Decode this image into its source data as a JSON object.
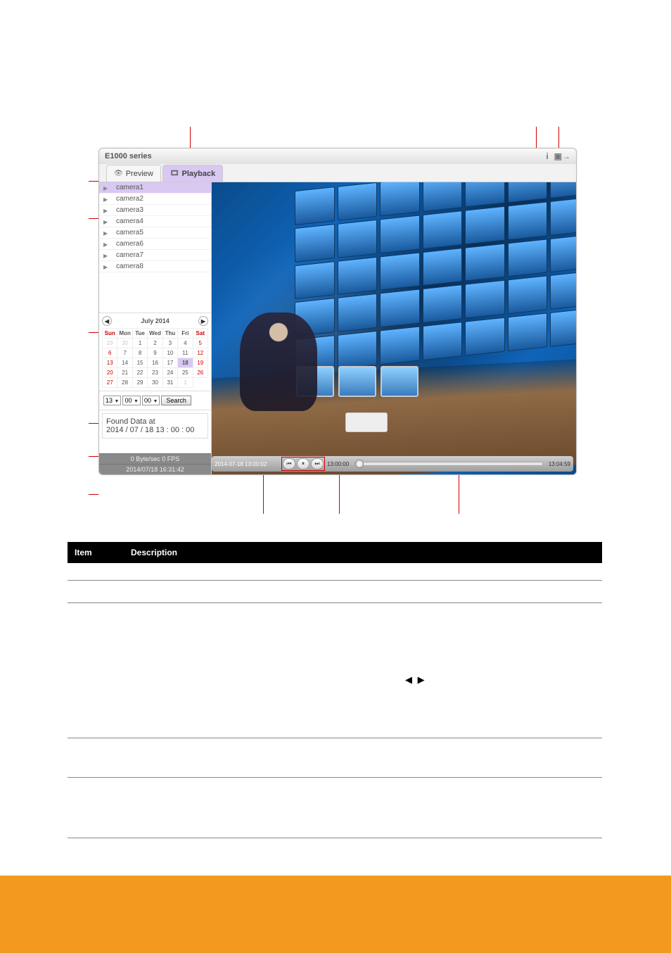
{
  "titlebar": {
    "title": "E1000 series"
  },
  "tabs": {
    "preview": "Preview",
    "playback": "Playback"
  },
  "cameras": [
    "camera1",
    "camera2",
    "camera3",
    "camera4",
    "camera5",
    "camera6",
    "camera7",
    "camera8"
  ],
  "calendar": {
    "month": "July 2014",
    "dow": [
      "Sun",
      "Mon",
      "Tue",
      "Wed",
      "Thu",
      "Fri",
      "Sat"
    ],
    "lead_dim": [
      29,
      30
    ],
    "days_in_month": 31,
    "trail_dim": [
      1
    ],
    "selected_day": 18
  },
  "time_search": {
    "hour": "13",
    "min": "00",
    "sec": "00",
    "search": "Search"
  },
  "found": {
    "label": "Found Data at",
    "value": "2014 / 07 / 18   13 : 00 : 00"
  },
  "status": {
    "rate": "0 Byte/sec 0 FPS",
    "clock": "2014/07/18 16:31:42"
  },
  "playback": {
    "stamp": "2014-07-18 13:00:02",
    "time_start": "13:00:00",
    "time_end": "13:04:59"
  },
  "desc_header": {
    "item": "Item",
    "desc": "Description"
  },
  "arrows_glyph": "◀ ▶",
  "link": {
    "label": ""
  }
}
